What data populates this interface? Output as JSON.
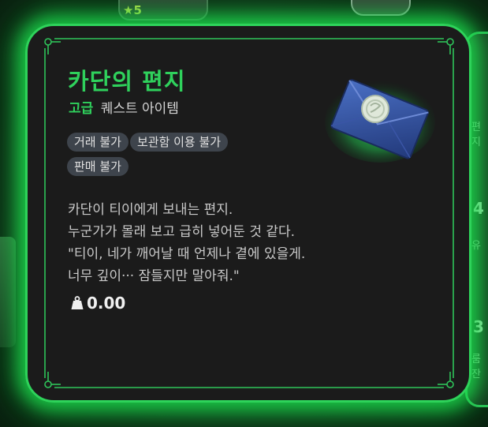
{
  "background": {
    "star_badge": "★5",
    "right_labels": [
      "편지",
      "유",
      "룸잔"
    ],
    "right_numbers": [
      "4",
      "3"
    ]
  },
  "item": {
    "name": "카단의 편지",
    "grade": "고급",
    "category": "퀘스트 아이템",
    "tags": [
      "거래 불가",
      "보관함 이용 불가",
      "판매 불가"
    ],
    "description_lines": [
      "카단이 티이에게 보내는 편지.",
      "누군가가 몰래 보고 급히 넣어둔 것 같다.",
      "\"티이, 네가 깨어날 때 언제나 곁에 있을게.",
      "너무 깊이··· 잠들지만 말아줘.\""
    ],
    "weight": "0.00",
    "icon": "sealed-envelope-icon"
  },
  "colors": {
    "grade_green": "#2fd15c",
    "glow": "#1ee650",
    "card_bg": "#1b1b1b",
    "tag_bg": "#3e444c",
    "envelope": "#2f4f9a",
    "seal": "#d8e4d4"
  }
}
